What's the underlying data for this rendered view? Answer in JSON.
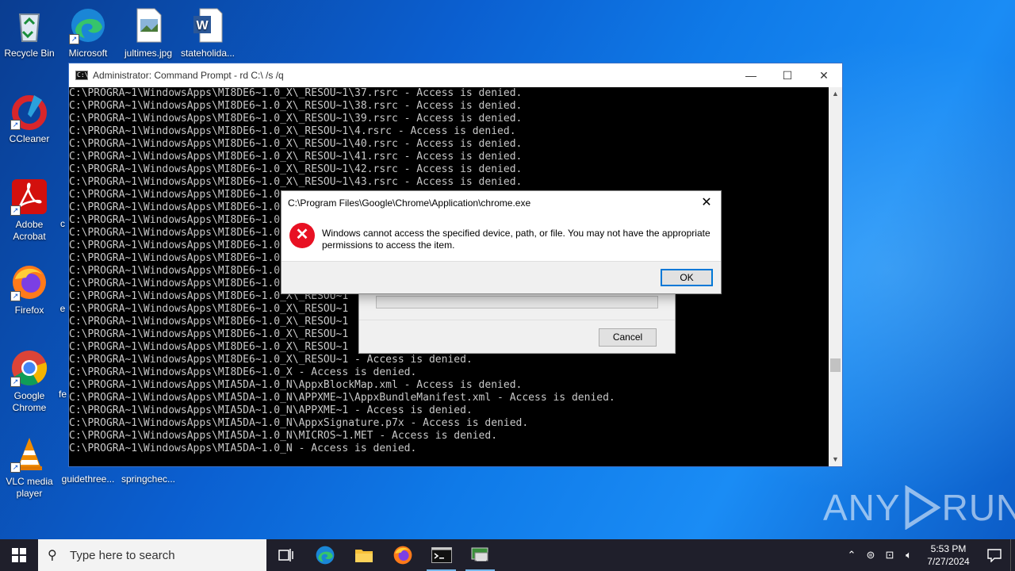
{
  "desktop": {
    "icons": [
      {
        "label": "Recycle Bin",
        "icon": "recycle-bin-icon"
      },
      {
        "label": "Microsoft Edge",
        "icon": "edge-icon"
      },
      {
        "label": "jultimes.jpg",
        "icon": "image-file-icon"
      },
      {
        "label": "stateholida...",
        "icon": "word-doc-icon"
      },
      {
        "label": "CCleaner",
        "icon": "ccleaner-icon"
      },
      {
        "label": "Adobe Acrobat",
        "icon": "acrobat-icon"
      },
      {
        "label": "Firefox",
        "icon": "firefox-icon"
      },
      {
        "label": "Google Chrome",
        "icon": "chrome-icon"
      },
      {
        "label": "VLC media player",
        "icon": "vlc-icon"
      },
      {
        "label": "guidethree...",
        "icon": "file-icon"
      },
      {
        "label": "springchec...",
        "icon": "file-icon"
      }
    ],
    "partial_labels": [
      "c",
      "e",
      "fe"
    ]
  },
  "console": {
    "title": "Administrator: Command Prompt - rd  C:\\ /s /q",
    "lines": [
      "C:\\PROGRA~1\\WindowsApps\\MI8DE6~1.0_X\\_RESOU~1\\37.rsrc - Access is denied.",
      "C:\\PROGRA~1\\WindowsApps\\MI8DE6~1.0_X\\_RESOU~1\\38.rsrc - Access is denied.",
      "C:\\PROGRA~1\\WindowsApps\\MI8DE6~1.0_X\\_RESOU~1\\39.rsrc - Access is denied.",
      "C:\\PROGRA~1\\WindowsApps\\MI8DE6~1.0_X\\_RESOU~1\\4.rsrc - Access is denied.",
      "C:\\PROGRA~1\\WindowsApps\\MI8DE6~1.0_X\\_RESOU~1\\40.rsrc - Access is denied.",
      "C:\\PROGRA~1\\WindowsApps\\MI8DE6~1.0_X\\_RESOU~1\\41.rsrc - Access is denied.",
      "C:\\PROGRA~1\\WindowsApps\\MI8DE6~1.0_X\\_RESOU~1\\42.rsrc - Access is denied.",
      "C:\\PROGRA~1\\WindowsApps\\MI8DE6~1.0_X\\_RESOU~1\\43.rsrc - Access is denied.",
      "C:\\PROGRA~1\\WindowsApps\\MI8DE6~1.0",
      "C:\\PROGRA~1\\WindowsApps\\MI8DE6~1.0",
      "C:\\PROGRA~1\\WindowsApps\\MI8DE6~1.0",
      "C:\\PROGRA~1\\WindowsApps\\MI8DE6~1.0",
      "C:\\PROGRA~1\\WindowsApps\\MI8DE6~1.0",
      "C:\\PROGRA~1\\WindowsApps\\MI8DE6~1.0",
      "C:\\PROGRA~1\\WindowsApps\\MI8DE6~1.0",
      "C:\\PROGRA~1\\WindowsApps\\MI8DE6~1.0",
      "C:\\PROGRA~1\\WindowsApps\\MI8DE6~1.0_X\\_RESOU~1",
      "C:\\PROGRA~1\\WindowsApps\\MI8DE6~1.0_X\\_RESOU~1",
      "C:\\PROGRA~1\\WindowsApps\\MI8DE6~1.0_X\\_RESOU~1",
      "C:\\PROGRA~1\\WindowsApps\\MI8DE6~1.0_X\\_RESOU~1",
      "C:\\PROGRA~1\\WindowsApps\\MI8DE6~1.0_X\\_RESOU~1",
      "C:\\PROGRA~1\\WindowsApps\\MI8DE6~1.0_X\\_RESOU~1 - Access is denied.",
      "C:\\PROGRA~1\\WindowsApps\\MI8DE6~1.0_X - Access is denied.",
      "C:\\PROGRA~1\\WindowsApps\\MIA5DA~1.0_N\\AppxBlockMap.xml - Access is denied.",
      "C:\\PROGRA~1\\WindowsApps\\MIA5DA~1.0_N\\APPXME~1\\AppxBundleManifest.xml - Access is denied.",
      "C:\\PROGRA~1\\WindowsApps\\MIA5DA~1.0_N\\APPXME~1 - Access is denied.",
      "C:\\PROGRA~1\\WindowsApps\\MIA5DA~1.0_N\\AppxSignature.p7x - Access is denied.",
      "C:\\PROGRA~1\\WindowsApps\\MIA5DA~1.0_N\\MICROS~1.MET - Access is denied.",
      "C:\\PROGRA~1\\WindowsApps\\MIA5DA~1.0_N - Access is denied."
    ]
  },
  "progress_dialog": {
    "cancel_label": "Cancel"
  },
  "error_dialog": {
    "title": "C:\\Program Files\\Google\\Chrome\\Application\\chrome.exe",
    "message": "Windows cannot access the specified device, path, or file. You may not have the appropriate permissions to access the item.",
    "ok_label": "OK"
  },
  "watermark": {
    "left": "ANY",
    "right": "RUN"
  },
  "taskbar": {
    "search_placeholder": "Type here to search",
    "pinned": [
      "task-view-icon",
      "edge-icon",
      "file-explorer-icon",
      "firefox-icon",
      "cmd-icon",
      "network-app-icon"
    ],
    "clock_time": "5:53 PM",
    "clock_date": "7/27/2024"
  },
  "colors": {
    "error_red": "#e81123",
    "accent": "#0078d7",
    "taskbar": "#1f1f2b"
  }
}
